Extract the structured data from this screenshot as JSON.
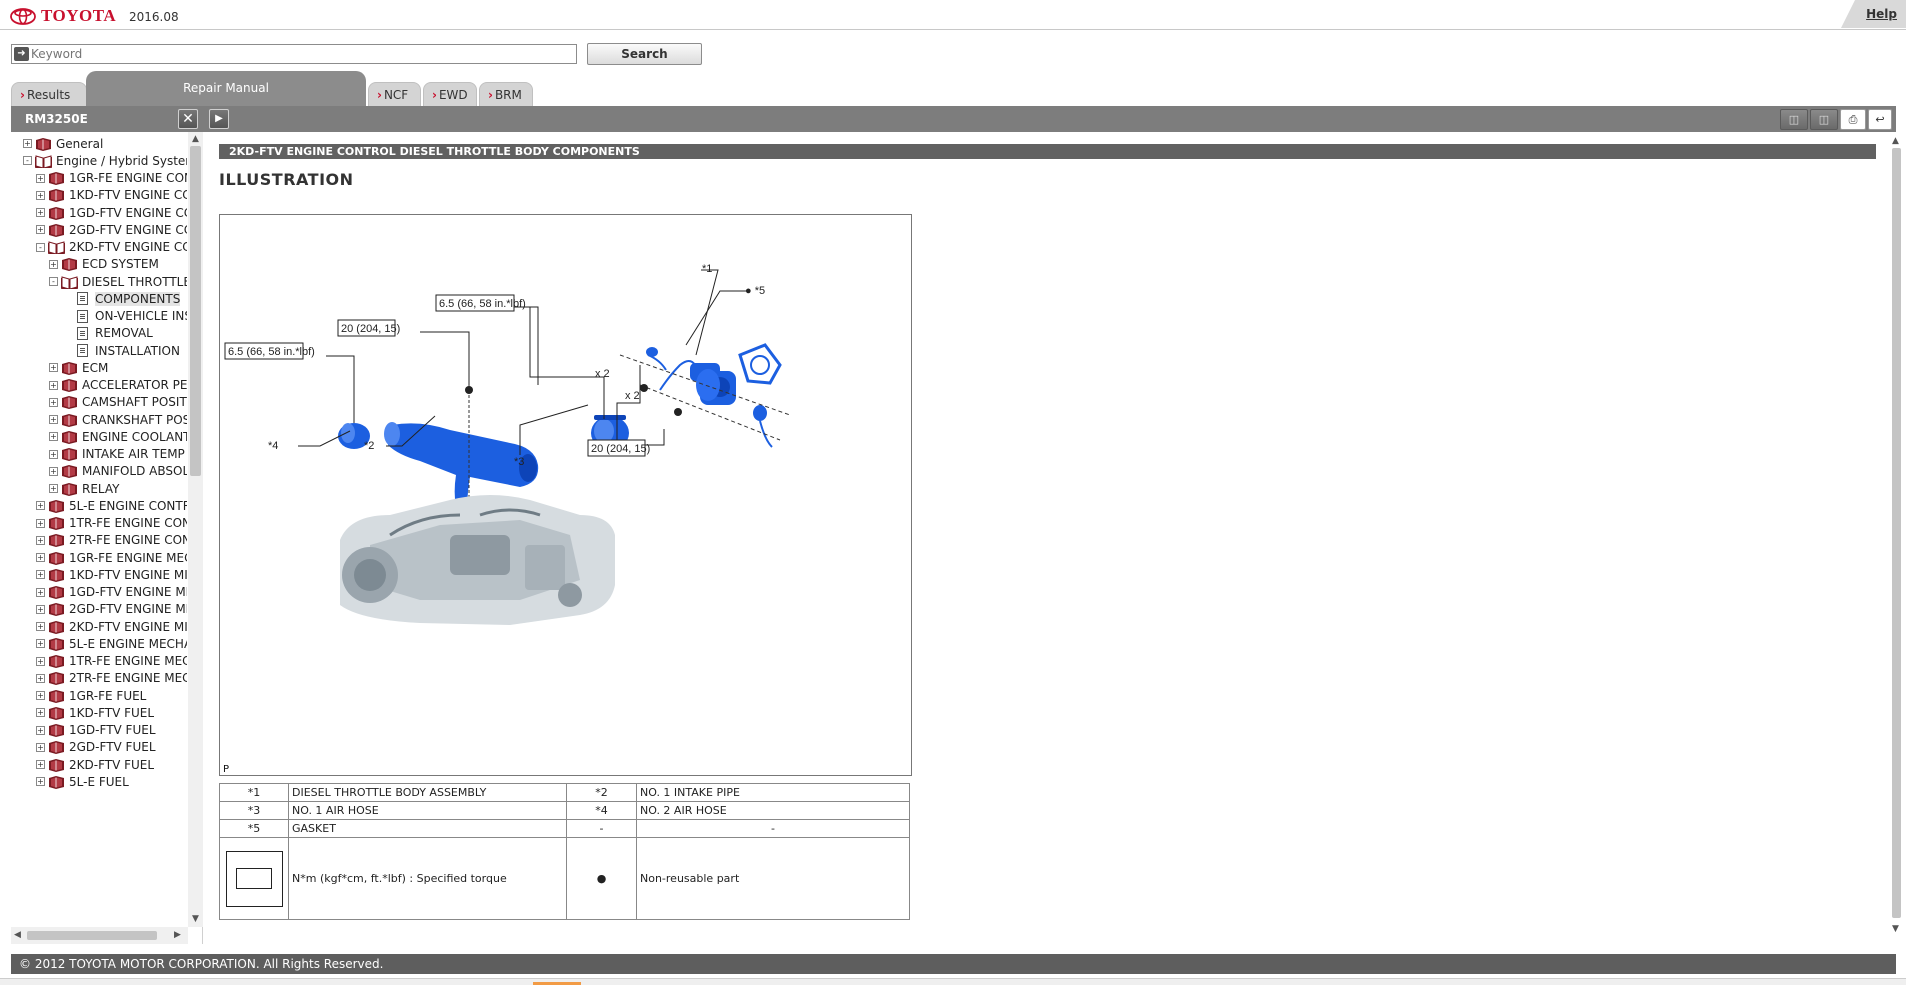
{
  "header": {
    "brand": "TOYOTA",
    "version": "2016.08",
    "help": "Help"
  },
  "search": {
    "placeholder": "Keyword",
    "button": "Search"
  },
  "tabs": {
    "results": "Results",
    "repair_manual": "Repair Manual",
    "ncf": "NCF",
    "ewd": "EWD",
    "brm": "BRM"
  },
  "tree": {
    "title": "RM3250E",
    "items": [
      {
        "label": "General",
        "level": 1,
        "expander": "+",
        "icon": "book"
      },
      {
        "label": "Engine / Hybrid Systen",
        "level": 1,
        "expander": "-",
        "icon": "book-open"
      },
      {
        "label": "1GR-FE ENGINE CON",
        "level": 2,
        "expander": "+",
        "icon": "book"
      },
      {
        "label": "1KD-FTV ENGINE CC",
        "level": 2,
        "expander": "+",
        "icon": "book"
      },
      {
        "label": "1GD-FTV ENGINE CC",
        "level": 2,
        "expander": "+",
        "icon": "book"
      },
      {
        "label": "2GD-FTV ENGINE CC",
        "level": 2,
        "expander": "+",
        "icon": "book"
      },
      {
        "label": "2KD-FTV ENGINE CC",
        "level": 2,
        "expander": "-",
        "icon": "book-open"
      },
      {
        "label": "ECD SYSTEM",
        "level": 3,
        "expander": "+",
        "icon": "book"
      },
      {
        "label": "DIESEL THROTTLE",
        "level": 3,
        "expander": "-",
        "icon": "book-open"
      },
      {
        "label": "COMPONENTS",
        "level": 4,
        "expander": "",
        "icon": "doc",
        "selected": true
      },
      {
        "label": "ON-VEHICLE INSP",
        "level": 4,
        "expander": "",
        "icon": "doc"
      },
      {
        "label": "REMOVAL",
        "level": 4,
        "expander": "",
        "icon": "doc"
      },
      {
        "label": "INSTALLATION",
        "level": 4,
        "expander": "",
        "icon": "doc"
      },
      {
        "label": "ECM",
        "level": 3,
        "expander": "+",
        "icon": "book"
      },
      {
        "label": "ACCELERATOR PE",
        "level": 3,
        "expander": "+",
        "icon": "book"
      },
      {
        "label": "CAMSHAFT POSIT",
        "level": 3,
        "expander": "+",
        "icon": "book"
      },
      {
        "label": "CRANKSHAFT POS",
        "level": 3,
        "expander": "+",
        "icon": "book"
      },
      {
        "label": "ENGINE COOLANT",
        "level": 3,
        "expander": "+",
        "icon": "book"
      },
      {
        "label": "INTAKE AIR TEMP",
        "level": 3,
        "expander": "+",
        "icon": "book"
      },
      {
        "label": "MANIFOLD ABSOL",
        "level": 3,
        "expander": "+",
        "icon": "book"
      },
      {
        "label": "RELAY",
        "level": 3,
        "expander": "+",
        "icon": "book"
      },
      {
        "label": "5L-E ENGINE CONTR",
        "level": 2,
        "expander": "+",
        "icon": "book"
      },
      {
        "label": "1TR-FE ENGINE CON",
        "level": 2,
        "expander": "+",
        "icon": "book"
      },
      {
        "label": "2TR-FE ENGINE CON",
        "level": 2,
        "expander": "+",
        "icon": "book"
      },
      {
        "label": "1GR-FE ENGINE MEC",
        "level": 2,
        "expander": "+",
        "icon": "book"
      },
      {
        "label": "1KD-FTV ENGINE MI",
        "level": 2,
        "expander": "+",
        "icon": "book"
      },
      {
        "label": "1GD-FTV ENGINE MI",
        "level": 2,
        "expander": "+",
        "icon": "book"
      },
      {
        "label": "2GD-FTV ENGINE MI",
        "level": 2,
        "expander": "+",
        "icon": "book"
      },
      {
        "label": "2KD-FTV ENGINE MI",
        "level": 2,
        "expander": "+",
        "icon": "book"
      },
      {
        "label": "5L-E ENGINE MECHA",
        "level": 2,
        "expander": "+",
        "icon": "book"
      },
      {
        "label": "1TR-FE ENGINE MEC",
        "level": 2,
        "expander": "+",
        "icon": "book"
      },
      {
        "label": "2TR-FE ENGINE MEC",
        "level": 2,
        "expander": "+",
        "icon": "book"
      },
      {
        "label": "1GR-FE FUEL",
        "level": 2,
        "expander": "+",
        "icon": "book"
      },
      {
        "label": "1KD-FTV FUEL",
        "level": 2,
        "expander": "+",
        "icon": "book"
      },
      {
        "label": "1GD-FTV FUEL",
        "level": 2,
        "expander": "+",
        "icon": "book"
      },
      {
        "label": "2GD-FTV FUEL",
        "level": 2,
        "expander": "+",
        "icon": "book"
      },
      {
        "label": "2KD-FTV FUEL",
        "level": 2,
        "expander": "+",
        "icon": "book"
      },
      {
        "label": "5L-E FUEL",
        "level": 2,
        "expander": "+",
        "icon": "book"
      }
    ]
  },
  "content": {
    "breadcrumb": "2KD-FTV ENGINE CONTROL  DIESEL THROTTLE BODY  COMPONENTS",
    "heading": "ILLUSTRATION",
    "illustration": {
      "callouts": {
        "p1": "*1",
        "p2": "*2",
        "p3": "*3",
        "p4": "*4",
        "p5": "● *5"
      },
      "torques": {
        "t_air_hose2": "6.5 (66, 58 in.*lbf)",
        "t_intake_pipe": "20 (204, 15)",
        "t_air_hose1": "6.5 (66, 58 in.*lbf)",
        "t_throttle": "20 (204, 15)"
      },
      "qty": {
        "q1": "x 2",
        "q2": "x 2"
      },
      "corner": "P"
    },
    "legend": {
      "rows": [
        {
          "k1": "*1",
          "v1": "DIESEL THROTTLE BODY ASSEMBLY",
          "k2": "*2",
          "v2": "NO. 1 INTAKE PIPE"
        },
        {
          "k1": "*3",
          "v1": "NO. 1 AIR HOSE",
          "k2": "*4",
          "v2": "NO. 2 AIR HOSE"
        },
        {
          "k1": "*5",
          "v1": "GASKET",
          "k2": "-",
          "v2": "-"
        }
      ],
      "torque_text": "N*m (kgf*cm, ft.*lbf) : Specified torque",
      "nonreuse_symbol": "●",
      "nonreuse_text": "Non-reusable part"
    }
  },
  "footer": {
    "copyright": "© 2012 TOYOTA MOTOR CORPORATION. All Rights Reserved."
  },
  "colors": {
    "brand_red": "#c8102e",
    "part_blue": "#1c5fe0",
    "toolbar_gray": "#7d7d7d"
  }
}
